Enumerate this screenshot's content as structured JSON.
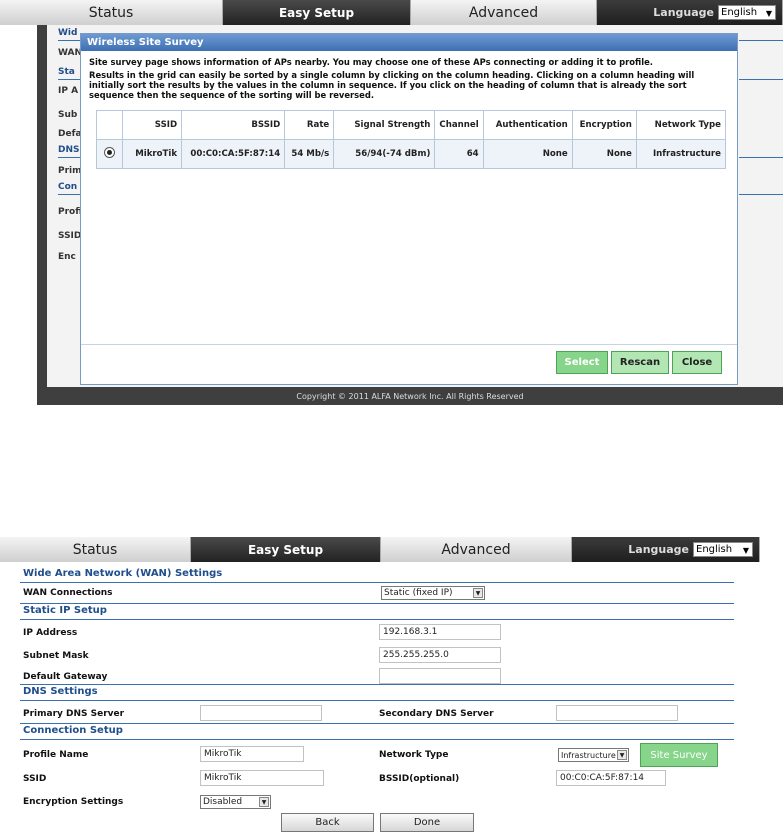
{
  "nav": {
    "tabs": [
      "Status",
      "Easy Setup",
      "Advanced"
    ],
    "language_label": "Language",
    "language_value": "English"
  },
  "background_labels": [
    "Wid",
    "WAN",
    "Sta",
    "IP A",
    "Sub",
    "Defa",
    "DNS",
    "Prim",
    "Con",
    "Profi",
    "SSID",
    "Enc"
  ],
  "dialog": {
    "title": "Wireless Site Survey",
    "intro": "Site survey page shows information of APs nearby. You may choose one of these APs connecting or adding it to profile.",
    "sort_help": "Results in the grid can easily be sorted by a single column by clicking on the column heading. Clicking on a column heading will initially sort the results by the values in the column in sequence. If you click on the heading of column that is already the sort sequence then the sequence of the sorting will be reversed.",
    "columns": [
      "SSID",
      "BSSID",
      "Rate",
      "Signal Strength",
      "Channel",
      "Authentication",
      "Encryption",
      "Network Type"
    ],
    "rows": [
      {
        "ssid": "MikroTik",
        "bssid": "00:C0:CA:5F:87:14",
        "rate": "54 Mb/s",
        "signal": "56/94(-74 dBm)",
        "channel": "64",
        "auth": "None",
        "enc": "None",
        "type": "Infrastructure"
      }
    ],
    "buttons": {
      "select": "Select",
      "rescan": "Rescan",
      "close": "Close"
    }
  },
  "copyright": "Copyright © 2011 ALFA Network Inc. All Rights Reserved",
  "form": {
    "sections": {
      "wan": "Wide Area Network (WAN) Settings",
      "static": "Static IP Setup",
      "dns": "DNS Settings",
      "conn": "Connection Setup"
    },
    "labels": {
      "wan_connections": "WAN Connections",
      "ip_address": "IP Address",
      "subnet_mask": "Subnet Mask",
      "default_gateway": "Default Gateway",
      "primary_dns": "Primary DNS Server",
      "secondary_dns": "Secondary DNS Server",
      "profile_name": "Profile Name",
      "network_type": "Network Type",
      "ssid": "SSID",
      "bssid": "BSSID(optional)",
      "encryption": "Encryption Settings"
    },
    "values": {
      "wan_connections": "Static (fixed IP)",
      "ip_address": "192.168.3.1",
      "subnet_mask": "255.255.255.0",
      "default_gateway": "",
      "primary_dns": "",
      "secondary_dns": "",
      "profile_name": "MikroTik",
      "network_type": "Infrastructure",
      "ssid": "MikroTik",
      "bssid": "00:C0:CA:5F:87:14",
      "encryption": "Disabled"
    },
    "site_survey": "Site Survey",
    "back": "Back",
    "done": "Done"
  }
}
